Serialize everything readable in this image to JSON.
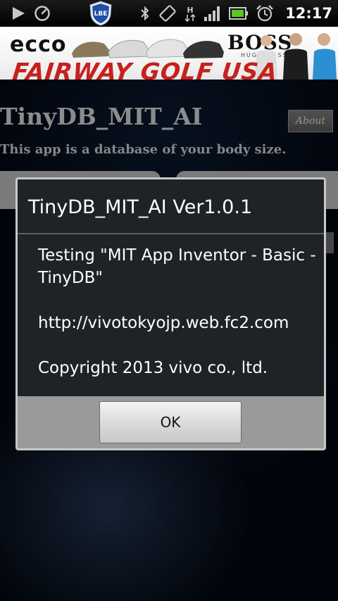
{
  "status_bar": {
    "icons": [
      "play-icon",
      "gauge-icon",
      "lbe-shield-icon",
      "bluetooth-icon",
      "rotation-icon",
      "hsdpa-icon",
      "signal-icon",
      "battery-icon",
      "alarm-icon"
    ],
    "lbe_label": "LBE",
    "network_label": "H",
    "time": "12:17"
  },
  "ad": {
    "brand_left": "ecco",
    "brand_right": "BOSS",
    "brand_right_sub": "HUGO BOSS",
    "tagline": "FAIRWAY GOLF USA"
  },
  "app": {
    "title": "TinyDB_MIT_AI",
    "subtitle": "This app is a database of your body size.",
    "about_label": "About"
  },
  "dialog": {
    "title": "TinyDB_MIT_AI Ver1.0.1",
    "line1": "Testing \"MIT App Inventor - Basic - TinyDB\"",
    "line2": "http://vivotokyojp.web.fc2.com",
    "line3": "Copyright 2013 vivo co., ltd.",
    "ok_label": "OK"
  },
  "colors": {
    "status_bar": "#000000",
    "dialog_bg": "#1f2326",
    "dialog_footer": "#9a9a9a",
    "ad_red": "#c8201e",
    "app_text": "#d8d8d8"
  }
}
